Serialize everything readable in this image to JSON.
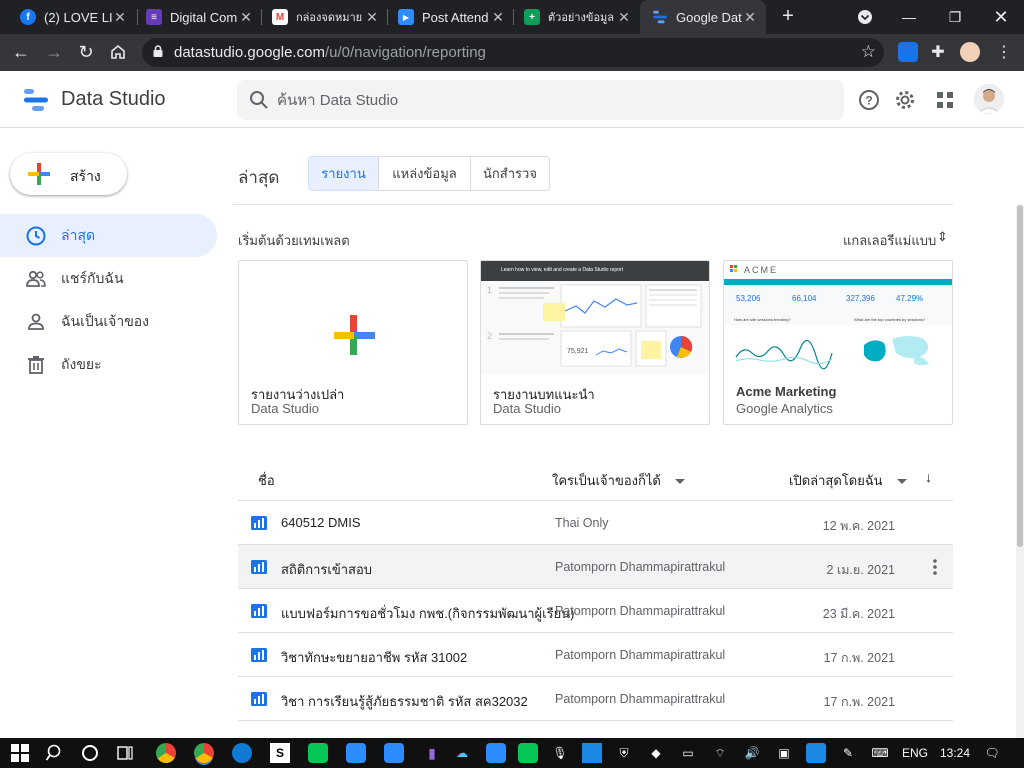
{
  "browser": {
    "tabs": [
      {
        "title": "(2) LOVE LII",
        "icon": "facebook-icon",
        "color": "#1877f2",
        "glyph": "f"
      },
      {
        "title": "Digital Com",
        "icon": "forms-icon",
        "color": "#673ab7",
        "glyph": "≡"
      },
      {
        "title": "กล่องจดหมาย",
        "icon": "gmail-icon",
        "color": "#ea4335",
        "glyph": "M"
      },
      {
        "title": "Post Attend",
        "icon": "zoom-icon",
        "color": "#2d8cff",
        "glyph": "▶"
      },
      {
        "title": "ตัวอย่างข้อมูล",
        "icon": "sheets-icon",
        "color": "#0f9d58",
        "glyph": "+"
      },
      {
        "title": "Google Dat",
        "icon": "data-studio-icon",
        "color": "#4285f4",
        "glyph": ""
      }
    ],
    "url_host": "datastudio.google.com",
    "url_path": "/u/0/navigation/reporting"
  },
  "app": {
    "name": "Data Studio",
    "search_placeholder": "ค้นหา Data Studio"
  },
  "sidebar": {
    "create_label": "สร้าง",
    "items": [
      {
        "label": "ล่าสุด",
        "icon": "clock-icon",
        "active": true
      },
      {
        "label": "แชร์กับฉัน",
        "icon": "people-icon",
        "active": false
      },
      {
        "label": "ฉันเป็นเจ้าของ",
        "icon": "person-icon",
        "active": false
      },
      {
        "label": "ถังขยะ",
        "icon": "trash-icon",
        "active": false
      }
    ]
  },
  "main": {
    "title": "ล่าสุด",
    "tabs": [
      "รายงาน",
      "แหล่งข้อมูล",
      "นักสำรวจ"
    ],
    "active_tab": 0,
    "templates_heading": "เริ่มต้นด้วยเทมเพลต",
    "gallery_label": "แกลเลอรีแม่แบบ",
    "templates": [
      {
        "title": "รายงานว่างเปล่า",
        "subtitle": "Data Studio"
      },
      {
        "title": "รายงานบทแนะนำ",
        "subtitle": "Data Studio",
        "preview_heading": "Learn how to view, edit and create a Data Studio report"
      },
      {
        "title": "Acme Marketing",
        "subtitle": "Google Analytics",
        "preview_brand": "ACME",
        "preview_metrics": [
          "53,206",
          "66,104",
          "327,396",
          "47.29%"
        ],
        "preview_q1": "How are site sessions trending?",
        "preview_q2": "What are the top countries by sessions?"
      }
    ],
    "table": {
      "col_name": "ชื่อ",
      "col_owner": "ใครเป็นเจ้าของก็ได้",
      "col_date": "เปิดล่าสุดโดยฉัน",
      "rows": [
        {
          "name": "640512 DMIS",
          "owner": "Thai Only",
          "date": "12 พ.ค. 2021"
        },
        {
          "name": "สถิติการเข้าสอบ",
          "owner": "Patomporn Dhammapirattrakul",
          "date": "2 เม.ย. 2021"
        },
        {
          "name": "แบบฟอร์มการขอชั่วโมง กพช.(กิจกรรมพัฒนาผู้เรียน)",
          "owner": "Patomporn Dhammapirattrakul",
          "date": "23 มี.ค. 2021"
        },
        {
          "name": " วิชาทักษะขยายอาชีพ รหัส 31002",
          "owner": "Patomporn Dhammapirattrakul",
          "date": "17 ก.พ. 2021"
        },
        {
          "name": "วิชา การเรียนรู้สู้ภัยธรรมชาติ รหัส สค32032",
          "owner": "Patomporn Dhammapirattrakul",
          "date": "17 ก.พ. 2021"
        }
      ]
    }
  },
  "taskbar": {
    "language": "ENG",
    "time": "13:24"
  },
  "colors": {
    "accent": "#1a73e8",
    "report_icon": "#1a73e8",
    "chrome_dark": "#202124"
  }
}
